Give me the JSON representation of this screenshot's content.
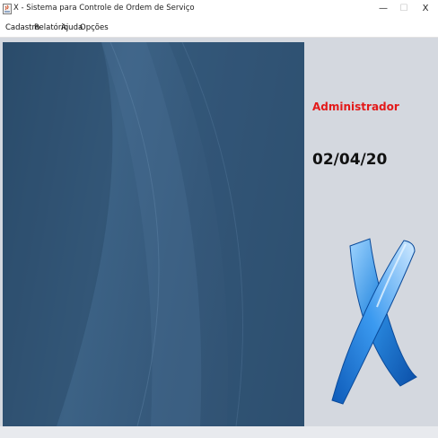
{
  "window": {
    "title": "X - Sistema para Controle de Ordem de Serviço",
    "minimize_glyph": "—",
    "maximize_glyph": "☐",
    "close_glyph": "X"
  },
  "menu": {
    "items": [
      {
        "label": "Cadastro"
      },
      {
        "label": "Relatório"
      },
      {
        "label": "Ajuda"
      },
      {
        "label": "Opções"
      }
    ]
  },
  "session": {
    "user": "Administrador",
    "date": "02/04/20",
    "user_color": "#e31a1a"
  },
  "icons": {
    "app": "java-app-icon",
    "logo": "x-logo-icon"
  }
}
